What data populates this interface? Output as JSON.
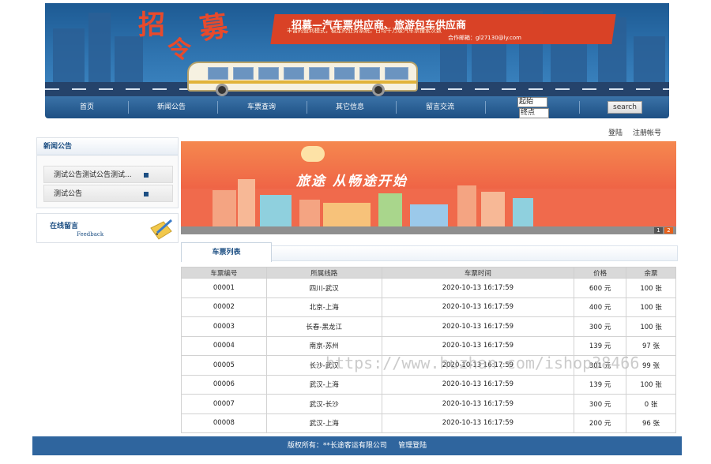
{
  "banner": {
    "title_chars": [
      "招",
      "募",
      "令"
    ],
    "ribbon_title": "招募—汽车票供应商、旅游包车供应商",
    "ribbon_sub": "丰富的盈利模式，稳定的业务系统，日均千万级汽车票搜索次数",
    "ribbon_mail": "合作邮箱：gl27130@ly.com"
  },
  "nav": {
    "items": [
      "首页",
      "新闻公告",
      "车票查询",
      "其它信息",
      "留言交流"
    ],
    "start_value": "起始",
    "end_value": "终点",
    "search_label": "search"
  },
  "auth": {
    "login": "登陆",
    "register": "注册帐号"
  },
  "sidebar": {
    "news_title": "新闻公告",
    "news_items": [
      "测试公告测试公告测试...",
      "测试公告"
    ],
    "message_title": "在线留言",
    "message_sub": "Feedback"
  },
  "slide": {
    "text": "旅途    从畅途开始",
    "pages": [
      "1",
      "2"
    ]
  },
  "tickets": {
    "tab_label": "车票列表",
    "headers": [
      "车票编号",
      "所属线路",
      "车票时间",
      "价格",
      "余票"
    ],
    "rows": [
      [
        "00001",
        "四川-武汉",
        "2020-10-13 16:17:59",
        "600 元",
        "100 张"
      ],
      [
        "00002",
        "北京-上海",
        "2020-10-13 16:17:59",
        "400 元",
        "100 张"
      ],
      [
        "00003",
        "长春-黑龙江",
        "2020-10-13 16:17:59",
        "300 元",
        "100 张"
      ],
      [
        "00004",
        "南京-苏州",
        "2020-10-13 16:17:59",
        "139 元",
        "97 张"
      ],
      [
        "00005",
        "长沙-武汉",
        "2020-10-13 16:17:59",
        "301 元",
        "99 张"
      ],
      [
        "00006",
        "武汉-上海",
        "2020-10-13 16:17:59",
        "139 元",
        "100 张"
      ],
      [
        "00007",
        "武汉-长沙",
        "2020-10-13 16:17:59",
        "300 元",
        "0 张"
      ],
      [
        "00008",
        "武汉-上海",
        "2020-10-13 16:17:59",
        "200 元",
        "96 张"
      ]
    ]
  },
  "watermark": "https://www.huzhan.com/ishop38466",
  "footer": {
    "copyright": "版权所有：**长途客运有限公司",
    "admin_link": "管理登陆"
  },
  "colors": {
    "nav_blue": "#1d4f83",
    "footer_blue": "#2f659e",
    "slide_orange": "#f06a4c"
  }
}
